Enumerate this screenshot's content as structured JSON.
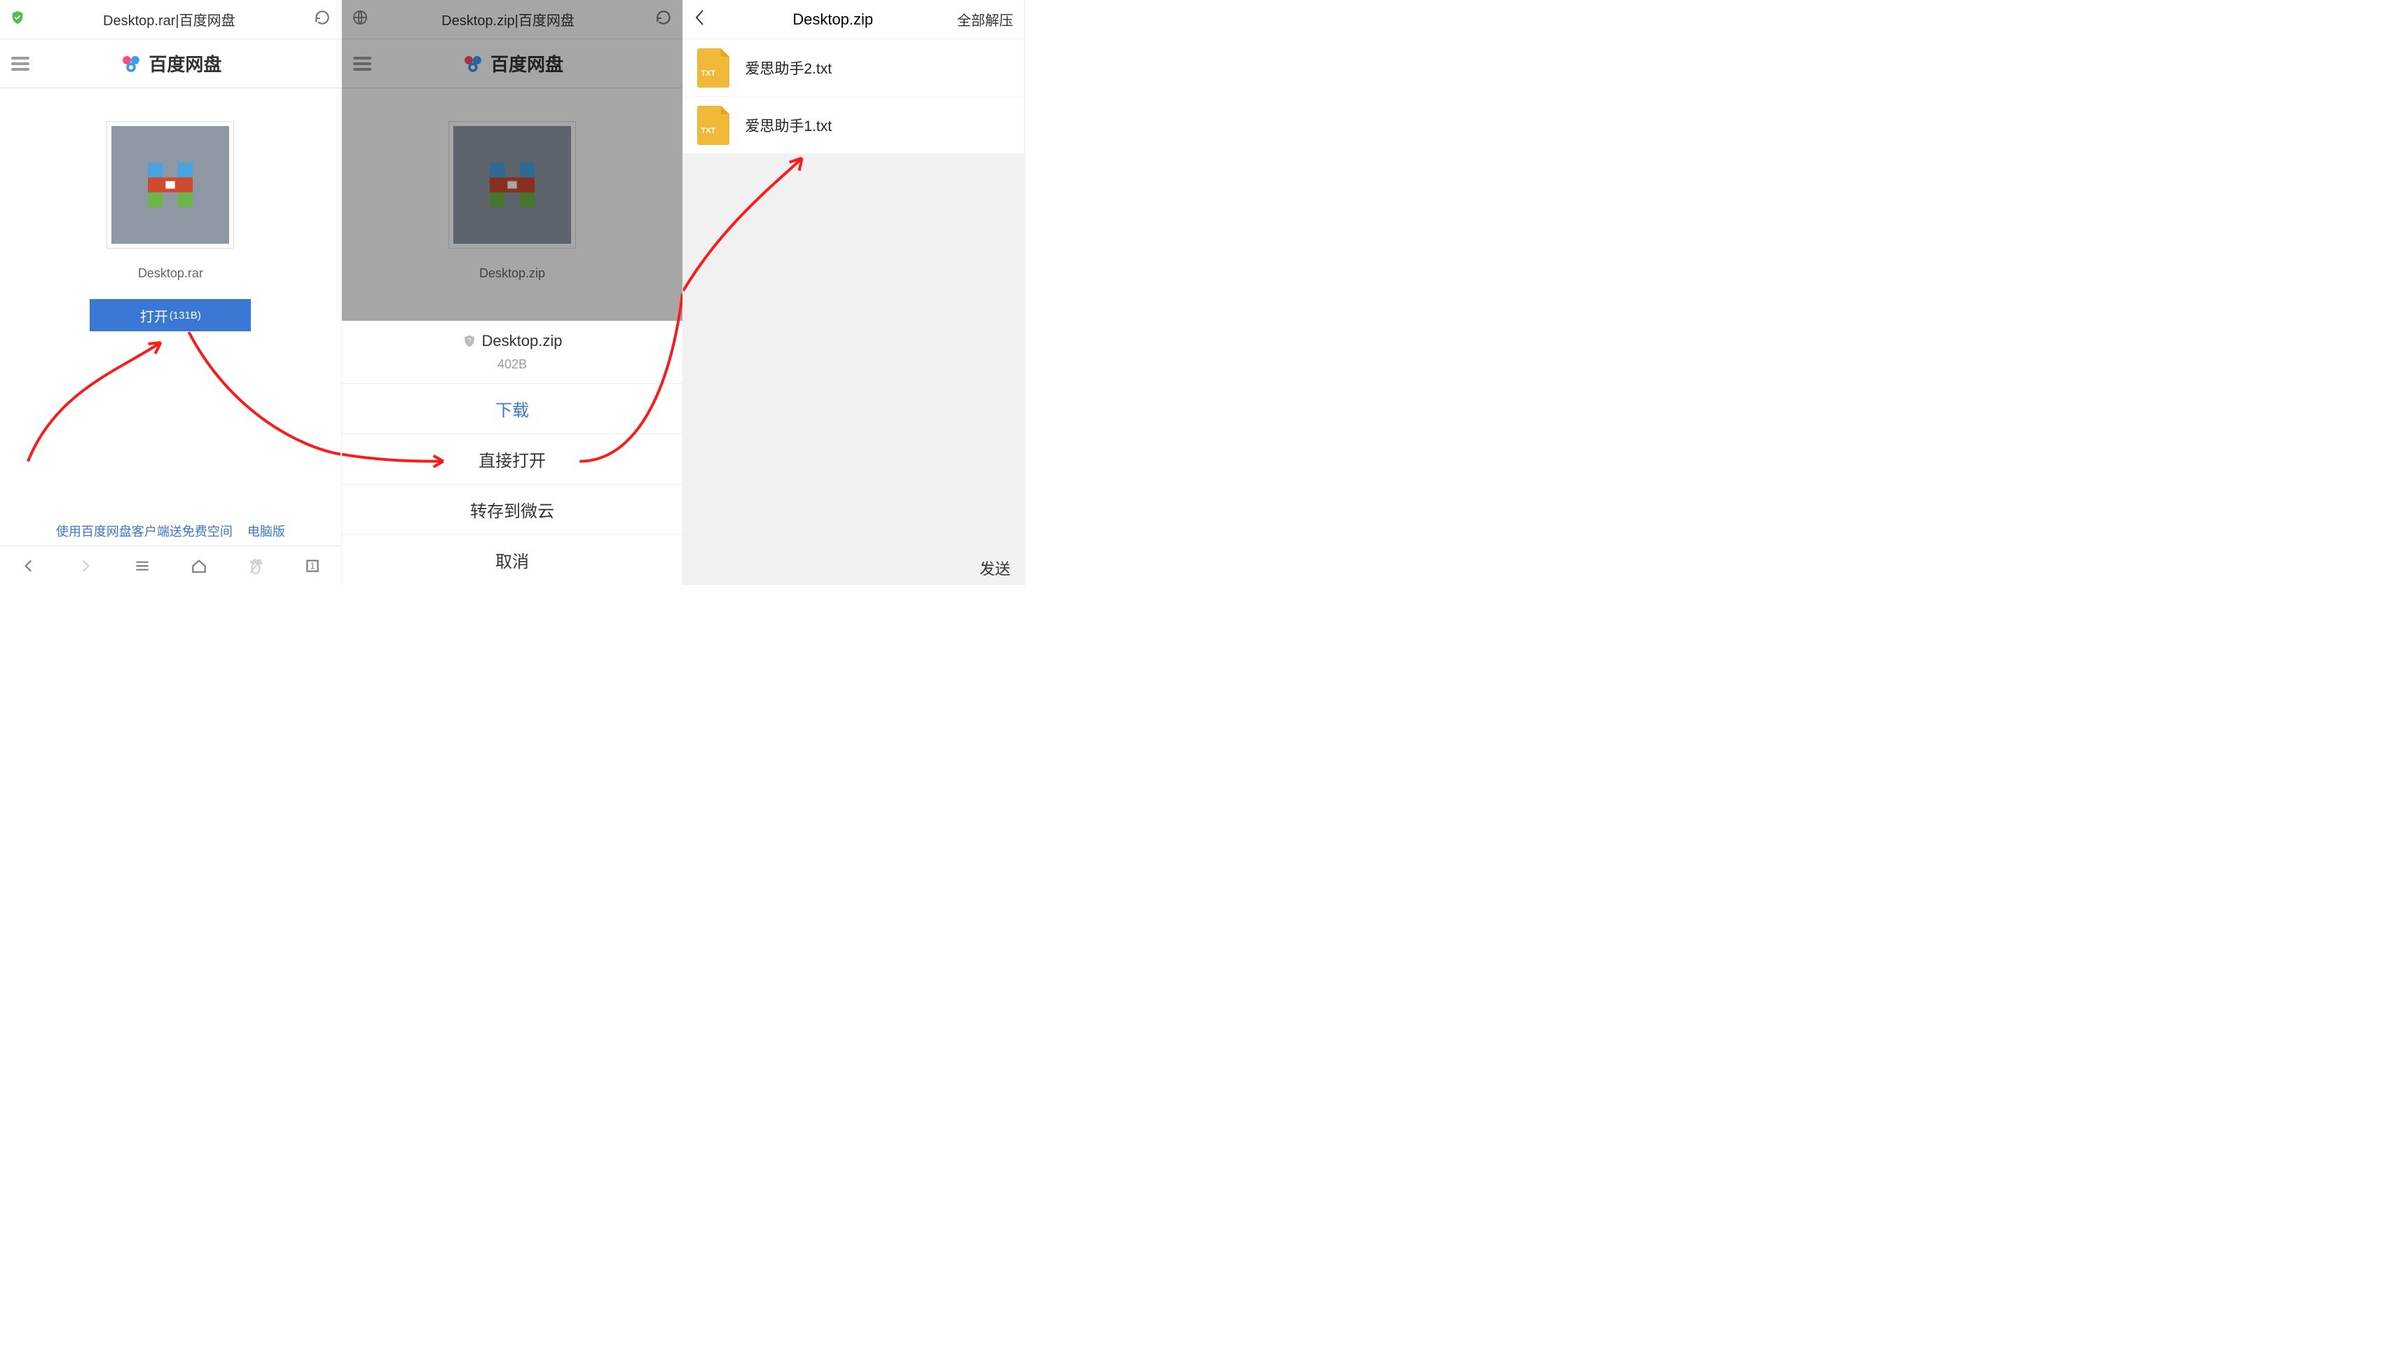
{
  "pane1": {
    "url_title": "Desktop.rar|百度网盘",
    "app_name": "百度网盘",
    "file_name": "Desktop.rar",
    "open_label": "打开",
    "open_size": "(131B)",
    "footer_link1": "使用百度网盘客户端送免费空间",
    "footer_link2": "电脑版",
    "tab_count": "1"
  },
  "pane2": {
    "url_title": "Desktop.zip|百度网盘",
    "app_name": "百度网盘",
    "file_name_preview": "Desktop.zip",
    "sheet_title": "Desktop.zip",
    "sheet_size": "402B",
    "opt_download": "下载",
    "opt_open": "直接打开",
    "opt_save": "转存到微云",
    "opt_cancel": "取消"
  },
  "pane3": {
    "title": "Desktop.zip",
    "action_all": "全部解压",
    "items": [
      {
        "name": "爱思助手2.txt",
        "ext": "TXT"
      },
      {
        "name": "爱思助手1.txt",
        "ext": "TXT"
      }
    ],
    "send": "发送"
  }
}
